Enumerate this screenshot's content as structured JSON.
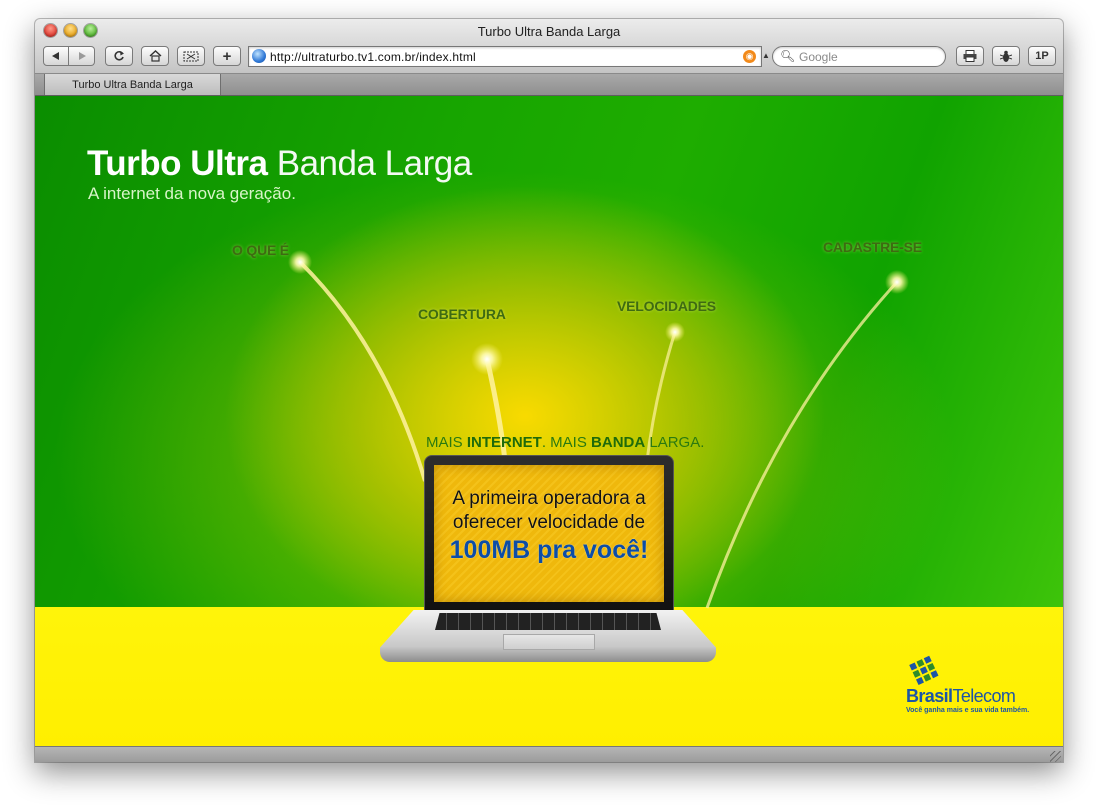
{
  "window": {
    "title": "Turbo Ultra Banda Larga"
  },
  "toolbar": {
    "back_icon": "back-arrow-icon",
    "forward_icon": "forward-arrow-icon",
    "reload_icon": "reload-icon",
    "home_icon": "home-icon",
    "snippet_icon": "web-clip-icon",
    "add_bookmark_label": "+",
    "url": "http://ultraturbo.tv1.com.br/index.html",
    "search_placeholder": "Google",
    "print_icon": "print-icon",
    "bug_icon": "bug-icon",
    "onepassword_label": "1P"
  },
  "tabs": [
    {
      "label": "Turbo Ultra Banda Larga",
      "active": true
    }
  ],
  "page": {
    "headline_bold": "Turbo Ultra",
    "headline_light": " Banda Larga",
    "subtitle": "A internet da nova geração.",
    "menu": [
      {
        "label": "O QUE É"
      },
      {
        "label": "COBERTURA"
      },
      {
        "label": "VELOCIDADES"
      },
      {
        "label": "CADASTRE-SE"
      }
    ],
    "tagline": {
      "p1": "MAIS ",
      "p2": "INTERNET",
      "p3": ". MAIS ",
      "p4": "BANDA",
      "p5": " LARGA."
    },
    "screen": {
      "line1": "A primeira operadora a",
      "line2": "oferecer velocidade de",
      "line3": "100MB pra você!"
    },
    "logo": {
      "name_bold": "Brasil",
      "name_light": "Telecom",
      "slogan": "Você ganha mais e sua vida também."
    },
    "colors": {
      "green": "#1fa800",
      "yellow": "#fff40a",
      "brand_blue": "#1c55a6"
    }
  }
}
